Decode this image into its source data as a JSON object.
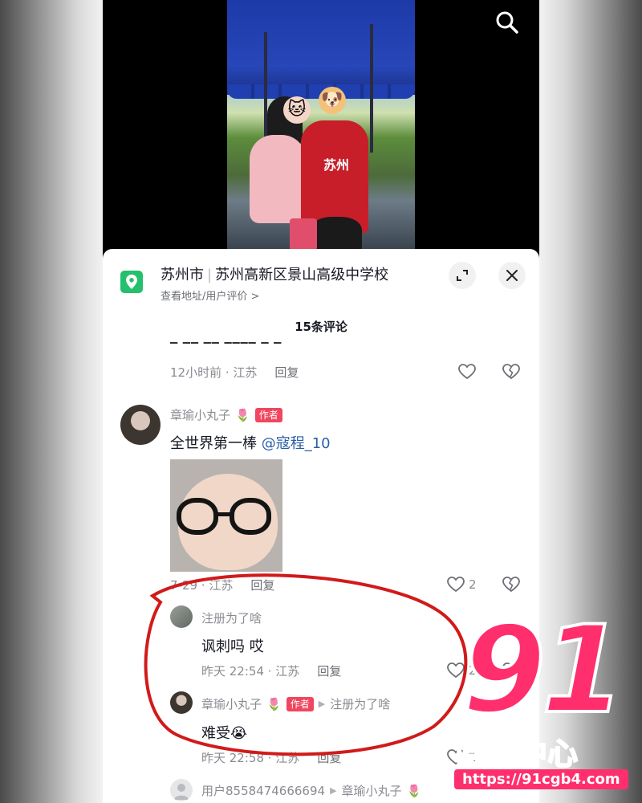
{
  "location": {
    "city": "苏州市",
    "place": "苏州高新区景山高级中学校",
    "subtitle": "查看地址/用户评价 >"
  },
  "comments_header": {
    "count_label": "15条评论"
  },
  "comments": [
    {
      "meta": "12小时前 · 江苏",
      "reply_label": "回复"
    },
    {
      "username": "章瑜小丸子",
      "badge": "作者",
      "text": "全世界第一棒",
      "mention": "@寇程_10",
      "meta": "7-29 · 江苏",
      "reply_label": "回复",
      "likes": "2",
      "replies": [
        {
          "username": "注册为了啥",
          "text": "讽刺吗 哎",
          "meta": "昨天 22:54 · 江苏",
          "reply_label": "回复",
          "likes": "2"
        },
        {
          "username": "章瑜小丸子",
          "badge": "作者",
          "reply_to": "注册为了啥",
          "text": "难受😭",
          "meta": "昨天 22:58 · 江苏",
          "reply_label": "回复",
          "likes": "2"
        },
        {
          "username": "用户8558474666694",
          "reply_to": "章瑜小丸子"
        }
      ]
    }
  ],
  "photo": {
    "jersey_text": "苏州"
  },
  "watermark": {
    "number": "91",
    "name": "吃瓜中心",
    "url": "https://91cgb4.com"
  },
  "colors": {
    "annotation_circle": "#d11a1a",
    "author_badge": "#f0465e",
    "mention": "#2a5ea8",
    "watermark": "#ff2f6e"
  }
}
